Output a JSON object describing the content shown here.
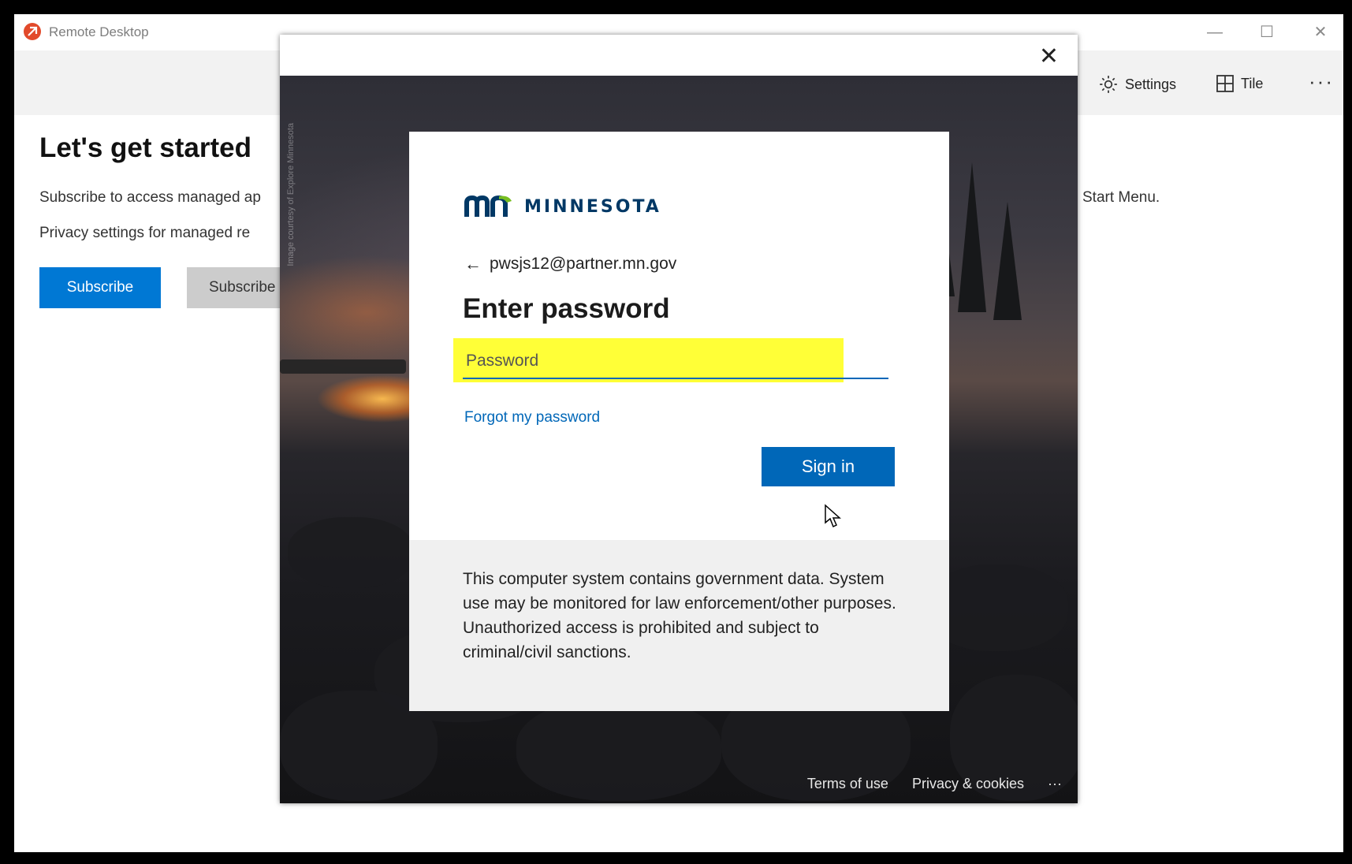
{
  "window": {
    "title": "Remote Desktop",
    "minimize_glyph": "—",
    "maximize_glyph": "☐",
    "close_glyph": "✕"
  },
  "toolbar": {
    "settings_label": "Settings",
    "tile_label": "Tile",
    "more_label": "···"
  },
  "welcome": {
    "heading": "Let's get started",
    "line1": "Subscribe to access managed ap",
    "line2": "Privacy settings for managed re",
    "right_text": "Start Menu.",
    "subscribe_button": "Subscribe",
    "subscribe_url_button": "Subscribe"
  },
  "dialog": {
    "close_glyph": "✕",
    "logo_text": "MINNESOTA",
    "account_email": "pwsjs12@partner.mn.gov",
    "back_glyph": "←",
    "title": "Enter password",
    "password_placeholder": "Password",
    "forgot_link": "Forgot my password",
    "sign_in_button": "Sign in",
    "disclaimer": "This computer system contains government data. System use may be monitored for law enforcement/other purposes. Unauthorized access is prohibited and subject to criminal/civil sanctions.",
    "footer_terms": "Terms of use",
    "footer_privacy": "Privacy & cookies",
    "footer_more": "···"
  },
  "colors": {
    "accent": "#0078d4",
    "signin_blue": "#0067b8",
    "highlight": "#ffff37",
    "logo_navy": "#003865"
  }
}
